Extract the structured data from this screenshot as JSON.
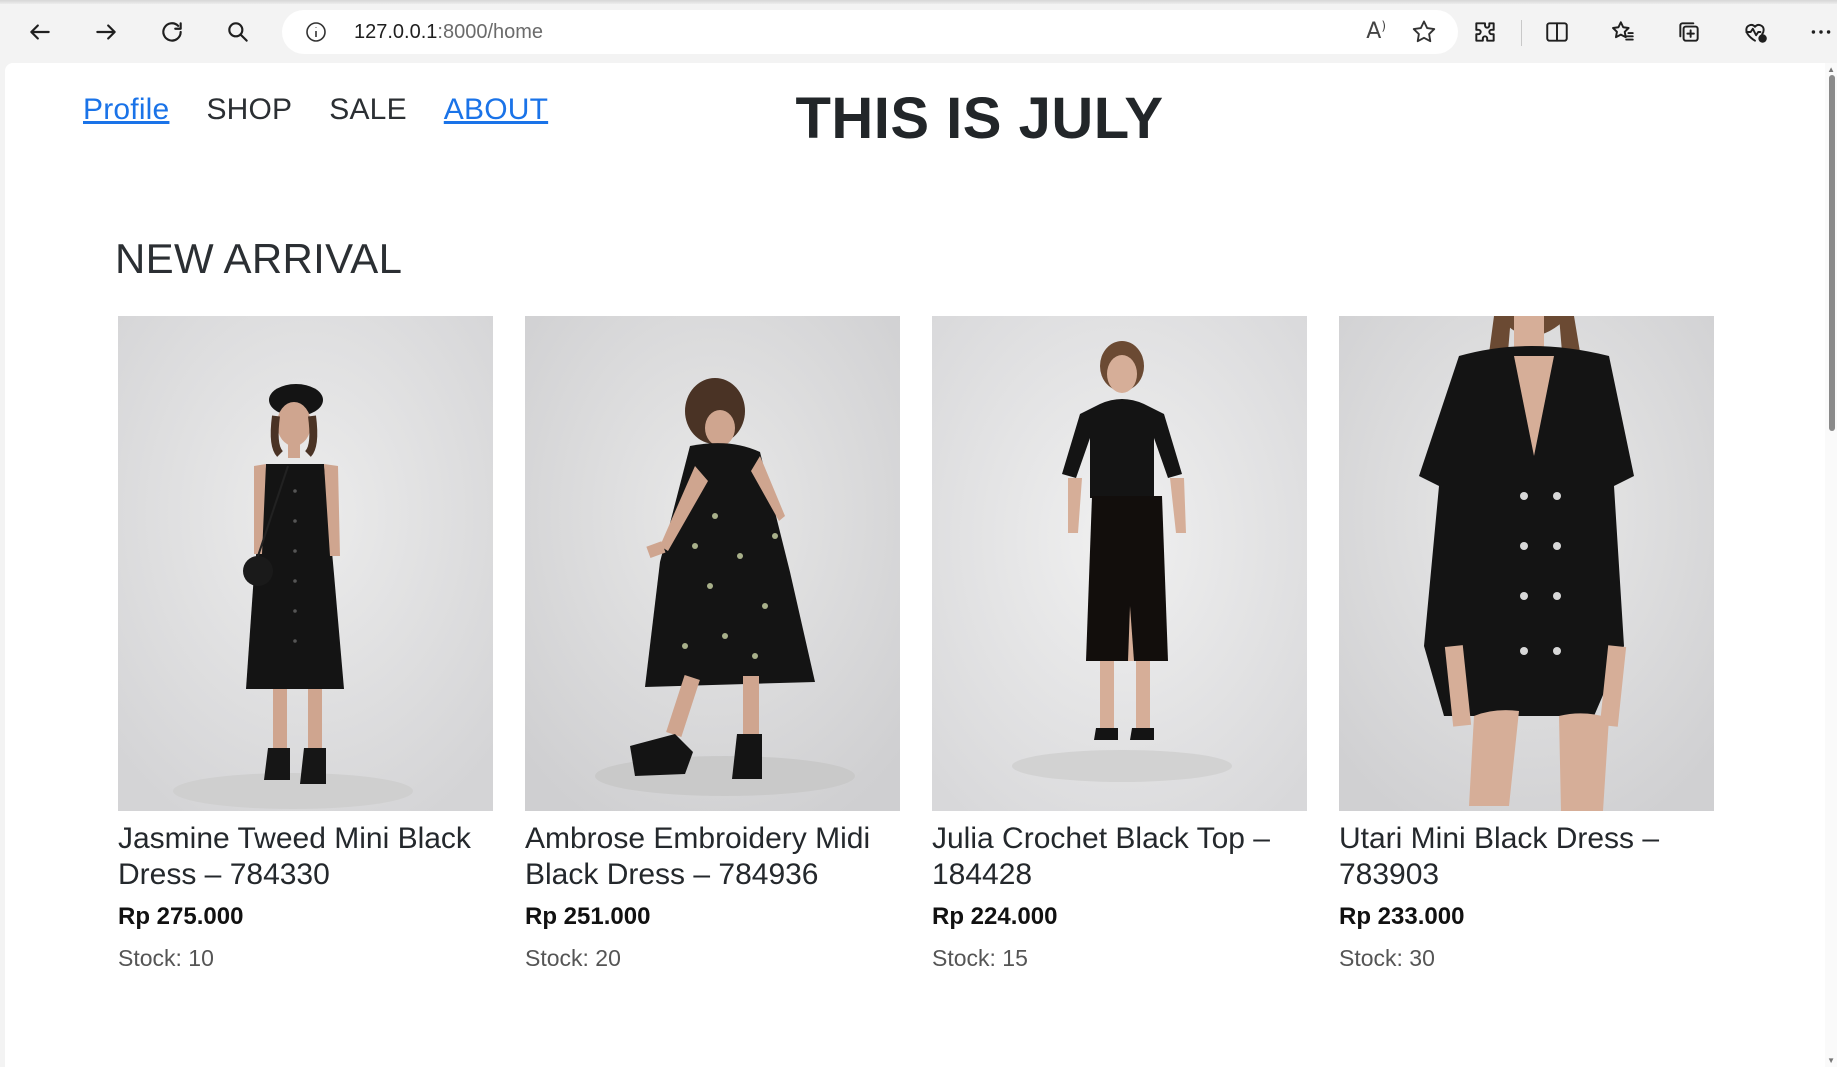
{
  "browser": {
    "url_host": "127.0.0.1",
    "url_path": ":8000/home",
    "read_aloud_glyph": "A",
    "icons": [
      "back-icon",
      "forward-icon",
      "refresh-icon",
      "search-icon",
      "site-info-icon",
      "read-aloud-icon",
      "favorite-star-icon",
      "extensions-icon",
      "split-screen-icon",
      "favorites-icon",
      "collections-icon",
      "browser-essentials-icon",
      "more-icon"
    ]
  },
  "nav": {
    "profile": "Profile",
    "shop": "SHOP",
    "sale": "SALE",
    "about": "ABOUT"
  },
  "brand": "THIS IS JULY",
  "section_title": "NEW ARRIVAL",
  "products": [
    {
      "name": "Jasmine Tweed Mini Black Dress – 784330",
      "price": "Rp 275.000",
      "stock": "Stock: 10"
    },
    {
      "name": "Ambrose Embroidery Midi Black Dress – 784936",
      "price": "Rp 251.000",
      "stock": "Stock: 20"
    },
    {
      "name": "Julia Crochet Black Top – 184428",
      "price": "Rp 224.000",
      "stock": "Stock: 15"
    },
    {
      "name": "Utari Mini Black Dress – 783903",
      "price": "Rp 233.000",
      "stock": "Stock: 30"
    }
  ],
  "colors": {
    "link": "#1a73e8",
    "text": "#24282c",
    "photo_background": "#e2e2e2",
    "garment": "#141414"
  }
}
